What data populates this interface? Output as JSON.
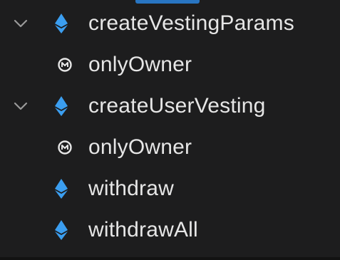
{
  "outline": {
    "items": [
      {
        "label": "createVestingParams",
        "kind": "function",
        "icon": "ethereum-icon",
        "expanded": true,
        "level": 0
      },
      {
        "label": "onlyOwner",
        "kind": "modifier",
        "icon": "modifier-icon",
        "level": 1
      },
      {
        "label": "createUserVesting",
        "kind": "function",
        "icon": "ethereum-icon",
        "expanded": true,
        "level": 0
      },
      {
        "label": "onlyOwner",
        "kind": "modifier",
        "icon": "modifier-icon",
        "level": 1
      },
      {
        "label": "withdraw",
        "kind": "function",
        "icon": "ethereum-icon",
        "level": 0
      },
      {
        "label": "withdrawAll",
        "kind": "function",
        "icon": "ethereum-icon",
        "level": 0
      }
    ]
  },
  "colors": {
    "background": "#1d1d1e",
    "text": "#e6e6e6",
    "accent": "#2a7fd4",
    "ethereum": "#3b9ef0",
    "chevron": "#9a9a9a"
  }
}
